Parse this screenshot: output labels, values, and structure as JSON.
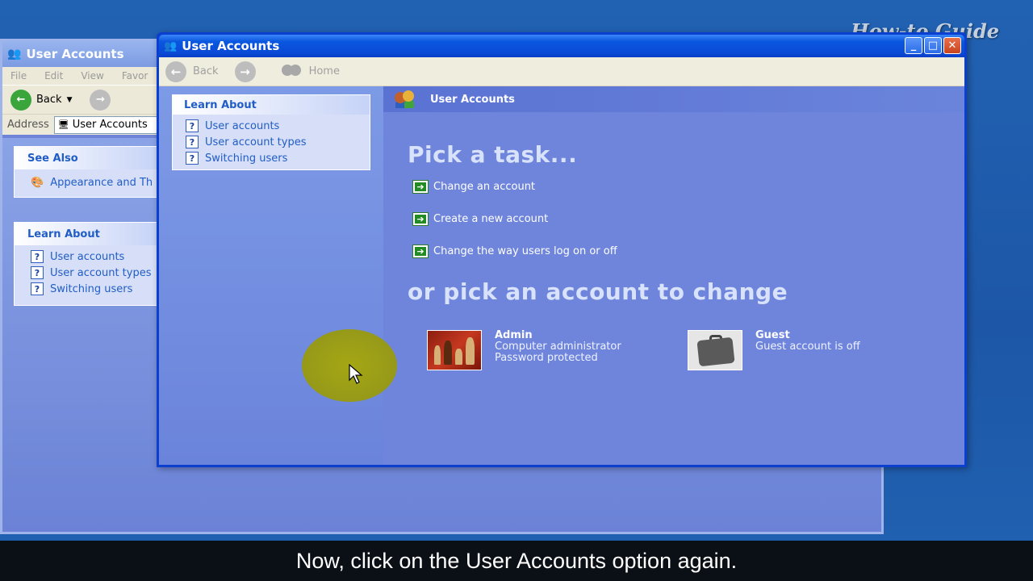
{
  "watermark": "How-to Guide",
  "background_window": {
    "title": "User Accounts",
    "menu": [
      "File",
      "Edit",
      "View",
      "Favor"
    ],
    "back_label": "Back",
    "address_label": "Address",
    "address_value": "User Accounts",
    "see_also": {
      "heading": "See Also",
      "items": [
        "Appearance and Th"
      ]
    },
    "learn_about": {
      "heading": "Learn About",
      "items": [
        "User accounts",
        "User account types",
        "Switching users"
      ]
    }
  },
  "window": {
    "title": "User Accounts",
    "toolbar": {
      "back": "Back",
      "home": "Home"
    },
    "learn_about": {
      "heading": "Learn About",
      "items": [
        "User accounts",
        "User account types",
        "Switching users"
      ]
    },
    "header_title": "User Accounts",
    "pick_task_heading": "Pick a task...",
    "tasks": [
      "Change an account",
      "Create a new account",
      "Change the way users log on or off"
    ],
    "pick_account_heading": "or pick an account to change",
    "accounts": [
      {
        "name": "Admin",
        "line1": "Computer administrator",
        "line2": "Password protected"
      },
      {
        "name": "Guest",
        "line1": "Guest account is off",
        "line2": ""
      }
    ]
  },
  "caption": "Now, click on the User Accounts option again.",
  "colors": {
    "title_bar": "#0a49d6",
    "task_pane": "#6f85dc",
    "link": "#215dc6",
    "cursor_highlight": "#a8a80a",
    "caption_bg": "#0b0f16"
  },
  "icons": [
    "user-accounts-icon",
    "help-icon",
    "green-arrow-icon",
    "chess-pieces-picture",
    "suitcase-picture",
    "back-arrow-icon",
    "forward-arrow-icon",
    "home-icon"
  ]
}
